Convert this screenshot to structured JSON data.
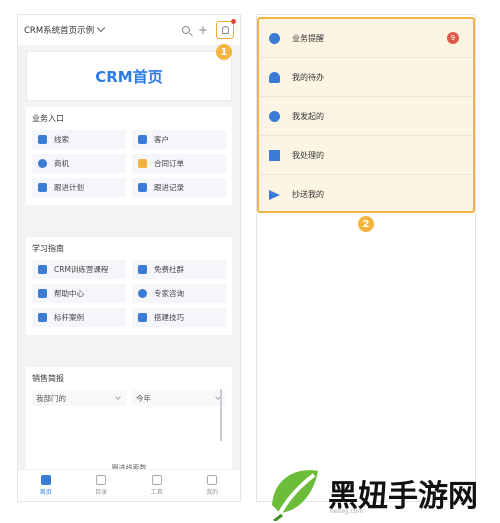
{
  "app": {
    "title": "CRM系统首页示例",
    "banner": "CRM首页"
  },
  "markers": {
    "one": "1",
    "two": "2"
  },
  "business_entry": {
    "title": "业务入口",
    "items": [
      {
        "label": "线索",
        "icon": "clue-icon"
      },
      {
        "label": "客户",
        "icon": "customer-icon"
      },
      {
        "label": "商机",
        "icon": "opportunity-icon"
      },
      {
        "label": "合同订单",
        "icon": "contract-icon"
      },
      {
        "label": "跟进计划",
        "icon": "plan-icon"
      },
      {
        "label": "跟进记录",
        "icon": "record-icon"
      }
    ]
  },
  "study_guide": {
    "title": "学习指南",
    "items": [
      {
        "label": "CRM训练营课程",
        "icon": "course-icon"
      },
      {
        "label": "免费社群",
        "icon": "community-icon"
      },
      {
        "label": "帮助中心",
        "icon": "help-icon"
      },
      {
        "label": "专家咨询",
        "icon": "expert-icon"
      },
      {
        "label": "标杆案例",
        "icon": "case-icon"
      },
      {
        "label": "搭建技巧",
        "icon": "tips-icon"
      }
    ]
  },
  "sales_report": {
    "title": "销售简报",
    "dept_select": "我部门的",
    "period_select": "今年",
    "caption": "跟进线索数"
  },
  "tabbar": [
    {
      "label": "首页",
      "active": true
    },
    {
      "label": "目录",
      "active": false
    },
    {
      "label": "工具",
      "active": false
    },
    {
      "label": "我的",
      "active": false
    }
  ],
  "notification_menu": [
    {
      "label": "业务提醒",
      "icon": "clock-icon",
      "badge": "9"
    },
    {
      "label": "我的待办",
      "icon": "bell-icon"
    },
    {
      "label": "我发起的",
      "icon": "play-icon"
    },
    {
      "label": "我处理的",
      "icon": "check-icon"
    },
    {
      "label": "抄送我的",
      "icon": "send-icon"
    }
  ],
  "watermark": {
    "text": "黑妞手游网",
    "small": "heitejj.com"
  },
  "colors": {
    "accent": "#2c7be5",
    "highlight": "#f0b442",
    "badge": "#e05a4a"
  }
}
